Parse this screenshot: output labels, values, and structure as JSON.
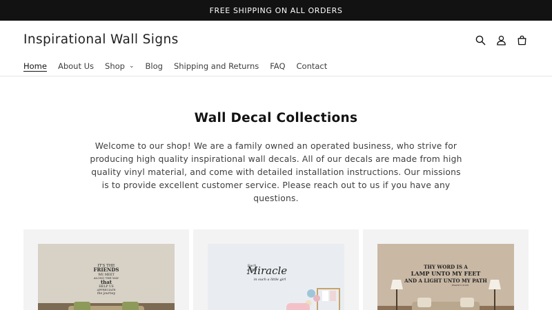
{
  "announcement": {
    "text": "FREE SHIPPING ON ALL ORDERS"
  },
  "header": {
    "brand": "Inspirational Wall Signs",
    "icons": [
      "search-icon",
      "account-icon",
      "cart-icon"
    ]
  },
  "nav": {
    "items": [
      {
        "label": "Home",
        "active": true
      },
      {
        "label": "About Us"
      },
      {
        "label": "Shop",
        "has_dropdown": true
      },
      {
        "label": "Blog"
      },
      {
        "label": "Shipping and Returns"
      },
      {
        "label": "FAQ"
      },
      {
        "label": "Contact"
      }
    ]
  },
  "collection": {
    "title": "Wall Decal Collections",
    "description": "Welcome to our shop! We are a family owned an operated business, who strive for producing high quality inspirational wall decals. All of our decals are made from high quality vinyl material, and come with detailed installation instructions. Our missions is to provide excellent customer service. Please reach out to us if you have any questions."
  },
  "cards": [
    {
      "decal_lines": [
        "IT'S THE",
        "FRIENDS",
        "WE MEET",
        "ALONG THE WAY",
        "that",
        "HELP US",
        "APPRECIATE",
        "the journey"
      ]
    },
    {
      "decal_lines": [
        "Such",
        "a tiny",
        "Miracle",
        "in such a little girl"
      ]
    },
    {
      "decal_lines": [
        "THY WORD IS A",
        "LAMP UNTO MY FEET",
        "AND A LIGHT UNTO MY PATH",
        "PSALM 119:105"
      ]
    }
  ],
  "colors": {
    "announcement_bg": "#121212",
    "card_bg": "#f3f3f3",
    "text": "#121212",
    "muted_text": "#3d3d3d"
  }
}
